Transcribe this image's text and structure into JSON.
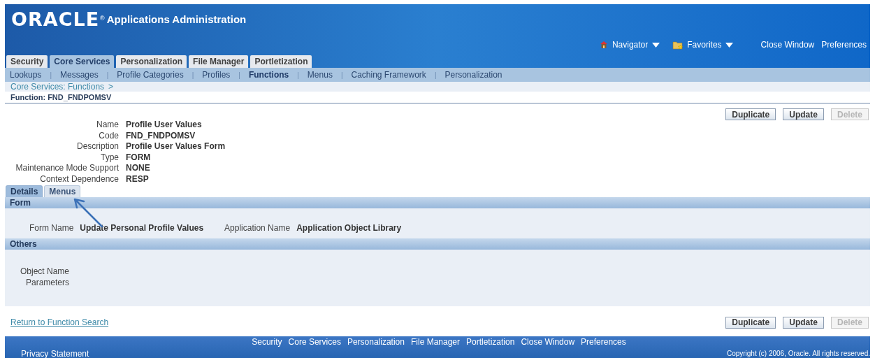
{
  "header": {
    "logo": "ORACLE",
    "logo_mark": "®",
    "title": "Applications Administration",
    "global_links": [
      {
        "kind": "navigator",
        "label": "Navigator"
      },
      {
        "kind": "favorites",
        "label": "Favorites"
      },
      {
        "kind": "link",
        "label": "Close Window"
      },
      {
        "kind": "link",
        "label": "Preferences"
      }
    ]
  },
  "tabs": [
    {
      "label": "Security",
      "selected": false
    },
    {
      "label": "Core Services",
      "selected": true
    },
    {
      "label": "Personalization",
      "selected": false
    },
    {
      "label": "File Manager",
      "selected": false
    },
    {
      "label": "Portletization",
      "selected": false
    }
  ],
  "subtabs": [
    {
      "label": "Lookups",
      "selected": false
    },
    {
      "label": "Messages",
      "selected": false
    },
    {
      "label": "Profile Categories",
      "selected": false
    },
    {
      "label": "Profiles",
      "selected": false
    },
    {
      "label": "Functions",
      "selected": true
    },
    {
      "label": "Menus",
      "selected": false
    },
    {
      "label": "Caching Framework",
      "selected": false
    },
    {
      "label": "Personalization",
      "selected": false
    }
  ],
  "subtab_separator": "|",
  "breadcrumb": {
    "link": "Core Services: Functions",
    "separator": ">"
  },
  "page_title": "Function: FND_FNDPOMSV",
  "buttons": [
    {
      "label": "Duplicate",
      "disabled": false
    },
    {
      "label": "Update",
      "disabled": false
    },
    {
      "label": "Delete",
      "disabled": true
    }
  ],
  "fields": [
    {
      "label": "Name",
      "value": "Profile User Values"
    },
    {
      "label": "Code",
      "value": "FND_FNDPOMSV"
    },
    {
      "label": "Description",
      "value": "Profile User Values Form"
    },
    {
      "label": "Type",
      "value": "FORM"
    },
    {
      "label": "Maintenance Mode Support",
      "value": "NONE"
    },
    {
      "label": "Context Dependence",
      "value": "RESP"
    }
  ],
  "detail_tabs": [
    {
      "label": "Details",
      "selected": true
    },
    {
      "label": "Menus",
      "selected": false
    }
  ],
  "form_section": {
    "title": "Form",
    "fields": [
      {
        "label": "Form Name",
        "value": "Update Personal Profile Values"
      },
      {
        "label": "Application Name",
        "value": "Application Object Library"
      }
    ]
  },
  "others_section": {
    "title": "Others",
    "labels": [
      "Object Name",
      "Parameters"
    ]
  },
  "return_link": "Return to Function Search",
  "bottom_buttons": [
    {
      "label": "Duplicate",
      "disabled": false
    },
    {
      "label": "Update",
      "disabled": false
    },
    {
      "label": "Delete",
      "disabled": true
    }
  ],
  "footer": {
    "links": [
      "Security",
      "Core Services",
      "Personalization",
      "File Manager",
      "Portletization",
      "Close Window",
      "Preferences"
    ],
    "privacy": "Privacy Statement",
    "copyright": "Copyright (c) 2006, Oracle. All rights reserved."
  }
}
